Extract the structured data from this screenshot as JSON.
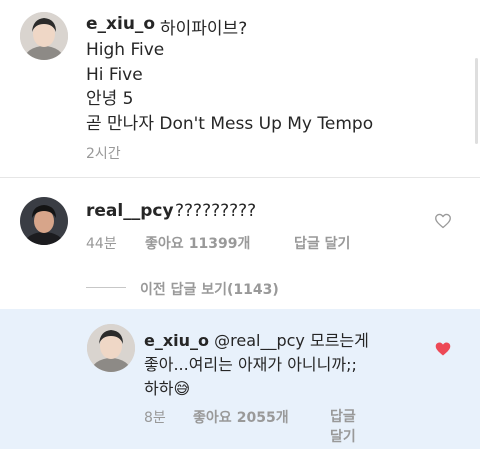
{
  "post": {
    "username": "e_xiu_o",
    "caption_line1": "하이파이브?",
    "caption_lines": [
      "High Five",
      "Hi Five",
      "안녕 5",
      "곧 만나자 Don't Mess Up My Tempo"
    ],
    "time": "2시간"
  },
  "comment1": {
    "username": "real__pcy",
    "text": "?????????",
    "time": "44분",
    "likes_label": "좋아요",
    "likes_count": "11399개",
    "reply_label": "답글 달기",
    "liked": false
  },
  "view_previous": "이전 답글 보기(1143)",
  "reply": {
    "username": "e_xiu_o",
    "mention": "@real__pcy",
    "text_line1": "모르는게",
    "text_line2": "좋아...여리는 아재가 아니니까;;",
    "text_line3": "하하",
    "emoji": "😅",
    "time": "8분",
    "likes_label": "좋아요",
    "likes_count": "2055개",
    "reply_label_line1": "답글",
    "reply_label_line2": "달기",
    "liked": true
  },
  "colors": {
    "text": "#262626",
    "muted": "#999999",
    "reply_background": "#e8f1fb",
    "like_red": "#ed4956"
  },
  "icons": {
    "comment1_like": "heart-outline-icon",
    "reply_like": "heart-filled-icon"
  }
}
